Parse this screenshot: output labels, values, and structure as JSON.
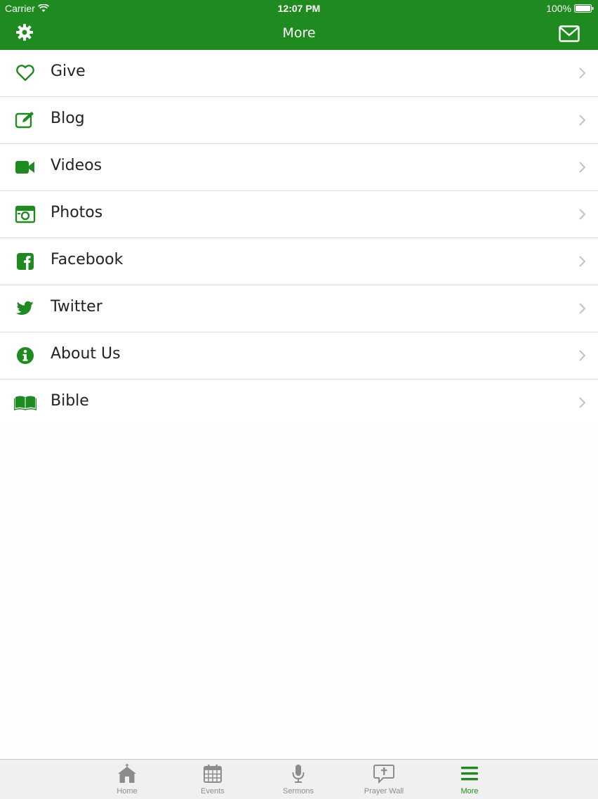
{
  "status_bar": {
    "carrier": "Carrier",
    "time": "12:07 PM",
    "battery": "100%"
  },
  "nav": {
    "title": "More",
    "left_icon": "gear-icon",
    "right_icon": "mail-icon"
  },
  "menu": [
    {
      "label": "Give",
      "icon": "heart-icon"
    },
    {
      "label": "Blog",
      "icon": "edit-icon"
    },
    {
      "label": "Videos",
      "icon": "video-camera-icon"
    },
    {
      "label": "Photos",
      "icon": "camera-icon"
    },
    {
      "label": "Facebook",
      "icon": "facebook-icon"
    },
    {
      "label": "Twitter",
      "icon": "twitter-icon"
    },
    {
      "label": "About Us",
      "icon": "info-icon"
    },
    {
      "label": "Bible",
      "icon": "open-book-icon"
    }
  ],
  "tabs": [
    {
      "label": "Home",
      "icon": "church-icon"
    },
    {
      "label": "Events",
      "icon": "calendar-icon"
    },
    {
      "label": "Sermons",
      "icon": "microphone-icon"
    },
    {
      "label": "Prayer Wall",
      "icon": "prayer-bubble-icon"
    },
    {
      "label": "More",
      "icon": "menu-lines-icon",
      "active": true
    }
  ],
  "colors": {
    "brand_green": "#1e8a1f",
    "tab_inactive": "#8c8c8c",
    "separator": "#dcdcdc"
  }
}
